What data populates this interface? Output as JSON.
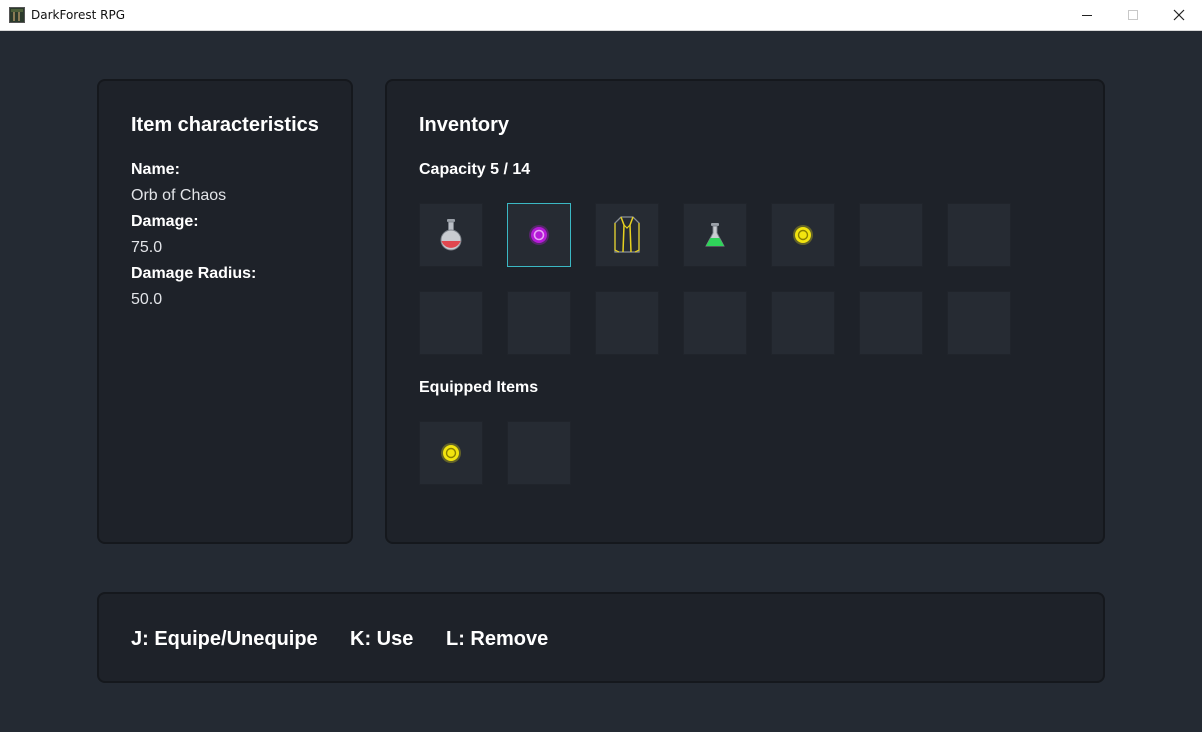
{
  "window": {
    "title": "DarkForest RPG",
    "controls": [
      "minimize-icon",
      "maximize-icon",
      "close-icon"
    ]
  },
  "characteristics": {
    "title": "Item characteristics",
    "name_label": "Name:",
    "name_value": "Orb of Chaos",
    "damage_label": "Damage:",
    "damage_value": "75.0",
    "radius_label": "Damage Radius:",
    "radius_value": "50.0"
  },
  "inventory": {
    "title": "Inventory",
    "capacity": "Capacity 5 / 14",
    "selected_slot": 1,
    "slots": [
      {
        "item": "health-potion-icon"
      },
      {
        "item": "chaos-orb-icon"
      },
      {
        "item": "robe-armor-icon"
      },
      {
        "item": "green-flask-icon"
      },
      {
        "item": "yellow-orb-icon"
      },
      {
        "item": ""
      },
      {
        "item": ""
      },
      {
        "item": ""
      },
      {
        "item": ""
      },
      {
        "item": ""
      },
      {
        "item": ""
      },
      {
        "item": ""
      },
      {
        "item": ""
      },
      {
        "item": ""
      }
    ],
    "equipped_title": "Equipped Items",
    "equipped": [
      {
        "item": "yellow-orb-icon"
      },
      {
        "item": ""
      }
    ]
  },
  "controls": {
    "equip": "J: Equipe/Unequipe",
    "use": "K: Use",
    "remove": "L: Remove"
  },
  "colors": {
    "background": "#242a33",
    "panel": "#1e2229",
    "slot": "#262b33",
    "selected_border": "#3bb8c4",
    "chaos_orb": "#b51ad8",
    "yellow_orb": "#f2e40f"
  }
}
